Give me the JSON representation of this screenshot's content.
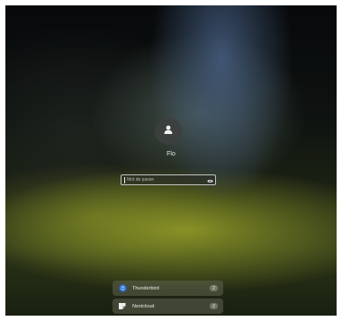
{
  "login": {
    "user_name": "Flo",
    "password_placeholder": "Mot de passe"
  },
  "notifications": [
    {
      "app": "Thunderbird",
      "count": "2",
      "icon": "thunderbird-icon"
    },
    {
      "app": "Nextcloud",
      "count": "2",
      "icon": "nextcloud-icon"
    }
  ],
  "colors": {
    "accent_blue": "#4a8fe0",
    "field_border": "#dcdcdc"
  }
}
